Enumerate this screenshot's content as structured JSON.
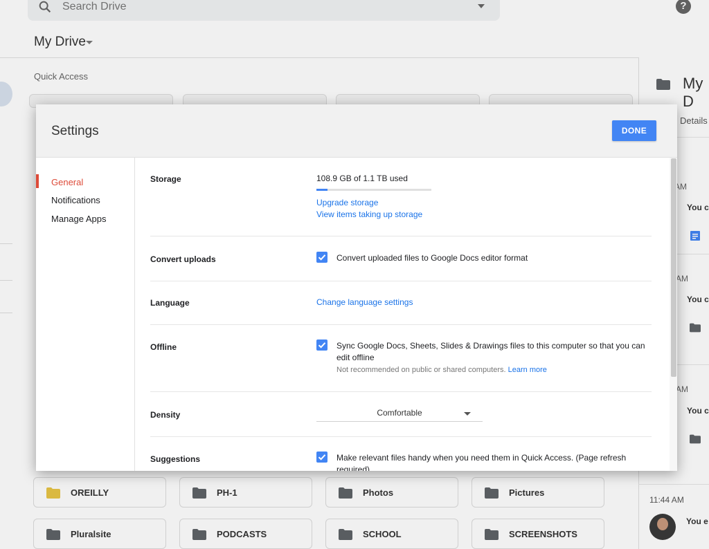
{
  "background": {
    "search_placeholder": "Search Drive",
    "breadcrumb": "My Drive",
    "quick_access_label": "Quick Access",
    "details_panel": {
      "title": "My D",
      "tab_label": "Details",
      "activity": [
        {
          "time": "AM",
          "actor": "You c"
        },
        {
          "time": "AM",
          "actor": "You c"
        },
        {
          "time": "AM",
          "actor": "You c"
        }
      ],
      "last_time": "11:44 AM",
      "last_actor": "You e"
    },
    "folders": [
      "OREILLY",
      "PH-1",
      "Photos",
      "Pictures",
      "Pluralsite",
      "PODCASTS",
      "SCHOOL",
      "SCREENSHOTS"
    ],
    "colors": {
      "folder_icon": "#5f6368",
      "shared_folder_icon": "#e8c547"
    }
  },
  "settings": {
    "title": "Settings",
    "done_label": "DONE",
    "nav": [
      {
        "label": "General",
        "active": true
      },
      {
        "label": "Notifications",
        "active": false
      },
      {
        "label": "Manage Apps",
        "active": false
      }
    ],
    "storage": {
      "label": "Storage",
      "usage_text": "108.9 GB of 1.1 TB used",
      "used_fraction": 0.099,
      "upgrade_link": "Upgrade storage",
      "view_items_link": "View items taking up storage"
    },
    "convert": {
      "label": "Convert uploads",
      "checked": true,
      "text": "Convert uploaded files to Google Docs editor format"
    },
    "language": {
      "label": "Language",
      "link": "Change language settings"
    },
    "offline": {
      "label": "Offline",
      "checked": true,
      "text_line1": "Sync Google Docs, Sheets, Slides & Drawings files to this computer so that you can",
      "text_line2": "edit offline",
      "note": "Not recommended on public or shared computers.",
      "learn_more": "Learn more"
    },
    "density": {
      "label": "Density",
      "selected": "Comfortable"
    },
    "suggestions": {
      "label": "Suggestions",
      "checked": true,
      "text_line1": "Make relevant files handy when you need them in Quick Access. (Page refresh",
      "text_line2": "required)"
    },
    "colors": {
      "accent": "#4285f4",
      "active_nav": "#dd4b39",
      "link": "#1a73e8"
    }
  }
}
